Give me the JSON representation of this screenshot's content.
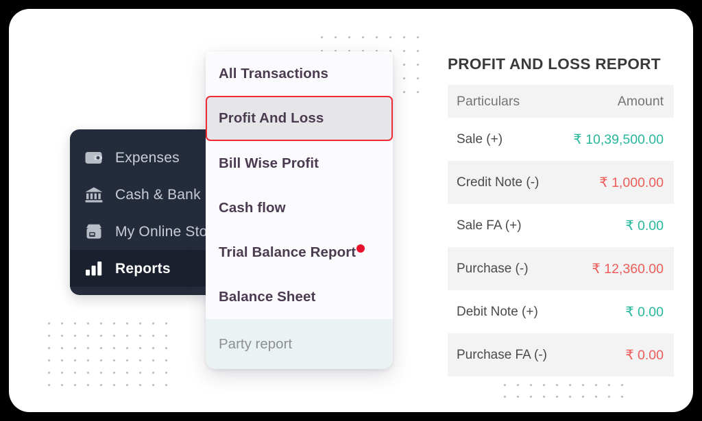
{
  "theme": {
    "page_background": "#000000",
    "canvas_background": "#ffffff",
    "sidebar_background": "#242c3b",
    "sidebar_active_background": "#1a202d",
    "menu_background": "#fbfafc",
    "menu_selected_background": "#e6e6e9",
    "menu_selected_border": "#ef2a35",
    "menu_footer_background": "#eaf3f1",
    "amount_positive": "#26b79c",
    "amount_negative": "#ec5c58",
    "badge_dot": "#e8112d",
    "dot_grid": "#b9b9bf",
    "table_row_shaded": "#f3f3f3"
  },
  "sidebar": {
    "items": [
      {
        "label": "Expenses",
        "icon": "wallet-icon",
        "active": false
      },
      {
        "label": "Cash & Bank",
        "icon": "bank-icon",
        "active": false
      },
      {
        "label": "My Online Store",
        "icon": "store-icon",
        "active": false
      },
      {
        "label": "Reports",
        "icon": "bar-chart-icon",
        "active": true
      }
    ]
  },
  "menu": {
    "items": [
      {
        "label": "All Transactions",
        "selected": false,
        "badge": false
      },
      {
        "label": "Profit And Loss",
        "selected": true,
        "badge": false
      },
      {
        "label": "Bill Wise Profit",
        "selected": false,
        "badge": false
      },
      {
        "label": "Cash flow",
        "selected": false,
        "badge": false
      },
      {
        "label": "Trial Balance Report",
        "selected": false,
        "badge": true
      },
      {
        "label": "Balance Sheet",
        "selected": false,
        "badge": false
      }
    ],
    "footer_label": "Party report"
  },
  "report": {
    "title": "PROFIT AND LOSS REPORT",
    "columns": [
      "Particulars",
      "Amount"
    ],
    "rows": [
      {
        "particulars": "Sale (+)",
        "amount": "₹ 10,39,500.00",
        "sign": "positive"
      },
      {
        "particulars": "Credit Note (-)",
        "amount": "₹ 1,000.00",
        "sign": "negative"
      },
      {
        "particulars": "Sale FA (+)",
        "amount": "₹ 0.00",
        "sign": "positive"
      },
      {
        "particulars": "Purchase (-)",
        "amount": "₹ 12,360.00",
        "sign": "negative"
      },
      {
        "particulars": "Debit Note (+)",
        "amount": "₹ 0.00",
        "sign": "positive"
      },
      {
        "particulars": "Purchase FA (-)",
        "amount": "₹ 0.00",
        "sign": "negative"
      }
    ]
  },
  "decor": {
    "dot_grid_top_right": {
      "cols": 8,
      "rows": 5
    },
    "dot_grid_bottom_left": {
      "cols": 10,
      "rows": 6
    },
    "dot_grid_bottom_center": {
      "cols": 10,
      "rows": 2
    }
  }
}
